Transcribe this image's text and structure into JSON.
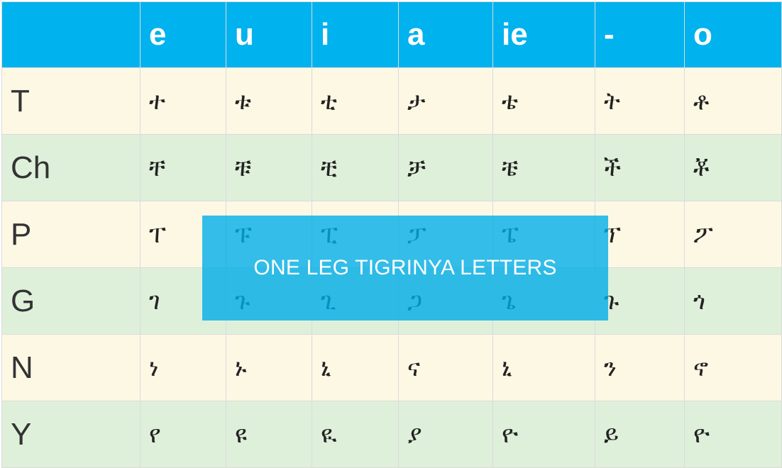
{
  "table": {
    "header": [
      "",
      "e",
      "u",
      "i",
      "a",
      "ie",
      "-",
      "o"
    ],
    "rows": [
      {
        "label": "T",
        "glyphs": [
          "ተ",
          "ቱ",
          "ቲ",
          "ታ",
          "ቴ",
          "ት",
          "ቶ"
        ]
      },
      {
        "label": "Ch",
        "glyphs": [
          "ቸ",
          "ቹ",
          "ቺ",
          "ቻ",
          "ቼ",
          "ች",
          "ቾ"
        ]
      },
      {
        "label": "P",
        "glyphs": [
          "ፐ",
          "ፑ",
          "ፒ",
          "ፓ",
          "ፔ",
          "ፕ",
          "ፖ"
        ]
      },
      {
        "label": "G",
        "glyphs": [
          "ገ",
          "ጉ",
          "ጊ",
          "ጋ",
          "ጌ",
          "ጉ",
          "ጎ"
        ]
      },
      {
        "label": "N",
        "glyphs": [
          "ነ",
          "ኑ",
          "ኒ",
          "ና",
          "ኒ",
          "ን",
          "ኖ"
        ]
      },
      {
        "label": "Y",
        "glyphs": [
          "የ",
          "ዩ",
          "ዪ",
          "ያ",
          "ዮ",
          "ይ",
          "ዮ"
        ]
      }
    ]
  },
  "overlay": {
    "text": "ONE LEG TIGRINYA LETTERS"
  },
  "colors": {
    "header_bg": "#00b2ee",
    "row_odd_bg": "#fdf8e4",
    "row_even_bg": "#dff0da",
    "overlay_bg": "#00aee8"
  }
}
